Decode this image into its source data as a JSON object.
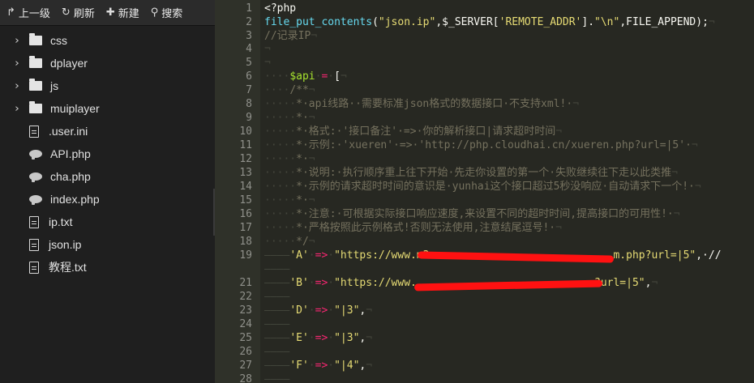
{
  "toolbar": {
    "up_label": "上一级",
    "refresh_label": "刷新",
    "new_label": "新建",
    "search_label": "搜索",
    "icons": {
      "up": "arrow-up-icon",
      "refresh": "refresh-icon",
      "new": "plus-icon",
      "search": "search-icon"
    }
  },
  "tree": [
    {
      "name": "css",
      "type": "folder",
      "icon": "folder-icon"
    },
    {
      "name": "dplayer",
      "type": "folder",
      "icon": "folder-icon"
    },
    {
      "name": "js",
      "type": "folder",
      "icon": "folder-icon"
    },
    {
      "name": "muiplayer",
      "type": "folder",
      "icon": "folder-icon"
    },
    {
      "name": ".user.ini",
      "type": "file",
      "icon": "document-icon"
    },
    {
      "name": "API.php",
      "type": "php",
      "icon": "php-elephant-icon"
    },
    {
      "name": "cha.php",
      "type": "php",
      "icon": "php-elephant-icon"
    },
    {
      "name": "index.php",
      "type": "php",
      "icon": "php-elephant-icon"
    },
    {
      "name": "ip.txt",
      "type": "file",
      "icon": "document-icon"
    },
    {
      "name": "json.ip",
      "type": "file",
      "icon": "document-icon"
    },
    {
      "name": "教程.txt",
      "type": "file",
      "icon": "document-icon"
    }
  ],
  "editor": {
    "lines": [
      {
        "n": "1",
        "tokens": [
          [
            "t-plain",
            "<?php"
          ]
        ]
      },
      {
        "n": "2",
        "tokens": [
          [
            "t-kw",
            "file_put_contents"
          ],
          [
            "t-plain",
            "("
          ],
          [
            "t-str",
            "\"json.ip\""
          ],
          [
            "t-plain",
            ",$_SERVER["
          ],
          [
            "t-str",
            "'REMOTE_ADDR'"
          ],
          [
            "t-plain",
            "]."
          ],
          [
            "t-str",
            "\"\\n\""
          ],
          [
            "t-plain",
            ",FILE_APPEND);"
          ],
          [
            "t-ws",
            "¬"
          ]
        ]
      },
      {
        "n": "3",
        "tokens": [
          [
            "t-cm",
            "//记录IP"
          ],
          [
            "t-ws",
            "¬"
          ]
        ]
      },
      {
        "n": "4",
        "tokens": [
          [
            "t-ws",
            "¬"
          ]
        ]
      },
      {
        "n": "5",
        "tokens": [
          [
            "t-ws",
            "¬"
          ]
        ]
      },
      {
        "n": "6",
        "tokens": [
          [
            "t-ws",
            "····"
          ],
          [
            "t-var",
            "$api"
          ],
          [
            "t-ws",
            "·"
          ],
          [
            "t-op",
            "="
          ],
          [
            "t-ws",
            "·"
          ],
          [
            "t-plain",
            "["
          ],
          [
            "t-ws",
            "¬"
          ]
        ]
      },
      {
        "n": "7",
        "tokens": [
          [
            "t-ws",
            "····"
          ],
          [
            "t-cm",
            "/**"
          ],
          [
            "t-ws",
            "¬"
          ]
        ]
      },
      {
        "n": "8",
        "tokens": [
          [
            "t-ws",
            "·····"
          ],
          [
            "t-cm",
            "*·api线路··需要标准json格式的数据接口·不支持xml!·"
          ],
          [
            "t-ws",
            "¬"
          ]
        ]
      },
      {
        "n": "9",
        "tokens": [
          [
            "t-ws",
            "·····"
          ],
          [
            "t-cm",
            "*·"
          ],
          [
            "t-ws",
            "¬"
          ]
        ]
      },
      {
        "n": "10",
        "tokens": [
          [
            "t-ws",
            "·····"
          ],
          [
            "t-cm",
            "*·格式:·'接口备注'·=>·你的解析接口|请求超时时间"
          ],
          [
            "t-ws",
            "¬"
          ]
        ]
      },
      {
        "n": "11",
        "tokens": [
          [
            "t-ws",
            "·····"
          ],
          [
            "t-cm",
            "*·示例:·'xueren'·=>·'http://php.cloudhai.cn/xueren.php?url=|5'·"
          ],
          [
            "t-ws",
            "¬"
          ]
        ]
      },
      {
        "n": "12",
        "tokens": [
          [
            "t-ws",
            "·····"
          ],
          [
            "t-cm",
            "*·"
          ],
          [
            "t-ws",
            "¬"
          ]
        ]
      },
      {
        "n": "13",
        "tokens": [
          [
            "t-ws",
            "·····"
          ],
          [
            "t-cm",
            "*·说明:·执行顺序重上往下开始·先走你设置的第一个·失败继续往下走以此类推"
          ],
          [
            "t-ws",
            "¬"
          ]
        ]
      },
      {
        "n": "14",
        "tokens": [
          [
            "t-ws",
            "·····"
          ],
          [
            "t-cm",
            "*·示例的请求超时时间的意识是·yunhai这个接口超过5秒没响应·自动请求下一个!·"
          ],
          [
            "t-ws",
            "¬"
          ]
        ]
      },
      {
        "n": "15",
        "tokens": [
          [
            "t-ws",
            "·····"
          ],
          [
            "t-cm",
            "*·"
          ],
          [
            "t-ws",
            "¬"
          ]
        ]
      },
      {
        "n": "16",
        "tokens": [
          [
            "t-ws",
            "·····"
          ],
          [
            "t-cm",
            "*·注意:·可根据实际接口响应速度,来设置不同的超时时间,提高接口的可用性!·"
          ],
          [
            "t-ws",
            "¬"
          ]
        ]
      },
      {
        "n": "17",
        "tokens": [
          [
            "t-ws",
            "·····"
          ],
          [
            "t-cm",
            "*·严格按照此示例格式!否则无法使用,注意结尾逗号!·"
          ],
          [
            "t-ws",
            "¬"
          ]
        ]
      },
      {
        "n": "18",
        "tokens": [
          [
            "t-ws",
            "·····"
          ],
          [
            "t-cm",
            "*/"
          ],
          [
            "t-ws",
            "¬"
          ]
        ]
      },
      {
        "n": "19",
        "tokens": [
          [
            "t-ws",
            "————"
          ],
          [
            "t-str",
            "'A'"
          ],
          [
            "t-ws",
            "·"
          ],
          [
            "t-op",
            "=>"
          ],
          [
            "t-ws",
            "·"
          ],
          [
            "t-str",
            "\"https://www.m3                             m.php?url=|5\""
          ],
          [
            "t-plain",
            ",·//"
          ]
        ]
      },
      {
        "n": "",
        "tokens": [
          [
            "t-ws",
            "————"
          ]
        ]
      },
      {
        "n": "21",
        "tokens": [
          [
            "t-ws",
            "————"
          ],
          [
            "t-str",
            "'B'"
          ],
          [
            "t-ws",
            "·"
          ],
          [
            "t-op",
            "=>"
          ],
          [
            "t-ws",
            "·"
          ],
          [
            "t-str",
            "\"https://www.                            ?url=|5\""
          ],
          [
            "t-plain",
            ","
          ],
          [
            "t-ws",
            "¬"
          ]
        ]
      },
      {
        "n": "22",
        "tokens": [
          [
            "t-ws",
            "————"
          ]
        ]
      },
      {
        "n": "23",
        "tokens": [
          [
            "t-ws",
            "————"
          ],
          [
            "t-str",
            "'D'"
          ],
          [
            "t-ws",
            "·"
          ],
          [
            "t-op",
            "=>"
          ],
          [
            "t-ws",
            "·"
          ],
          [
            "t-str",
            "\"|3\""
          ],
          [
            "t-plain",
            ","
          ],
          [
            "t-ws",
            "¬"
          ]
        ]
      },
      {
        "n": "24",
        "tokens": [
          [
            "t-ws",
            "————"
          ]
        ]
      },
      {
        "n": "25",
        "tokens": [
          [
            "t-ws",
            "————"
          ],
          [
            "t-str",
            "'E'"
          ],
          [
            "t-ws",
            "·"
          ],
          [
            "t-op",
            "=>"
          ],
          [
            "t-ws",
            "·"
          ],
          [
            "t-str",
            "\"|3\""
          ],
          [
            "t-plain",
            ","
          ],
          [
            "t-ws",
            "¬"
          ]
        ]
      },
      {
        "n": "26",
        "tokens": [
          [
            "t-ws",
            "————"
          ]
        ]
      },
      {
        "n": "27",
        "tokens": [
          [
            "t-ws",
            "————"
          ],
          [
            "t-str",
            "'F'"
          ],
          [
            "t-ws",
            "·"
          ],
          [
            "t-op",
            "=>"
          ],
          [
            "t-ws",
            "·"
          ],
          [
            "t-str",
            "\"|4\""
          ],
          [
            "t-plain",
            ","
          ],
          [
            "t-ws",
            "¬"
          ]
        ]
      },
      {
        "n": "28",
        "tokens": [
          [
            "t-ws",
            "————"
          ]
        ]
      }
    ]
  }
}
